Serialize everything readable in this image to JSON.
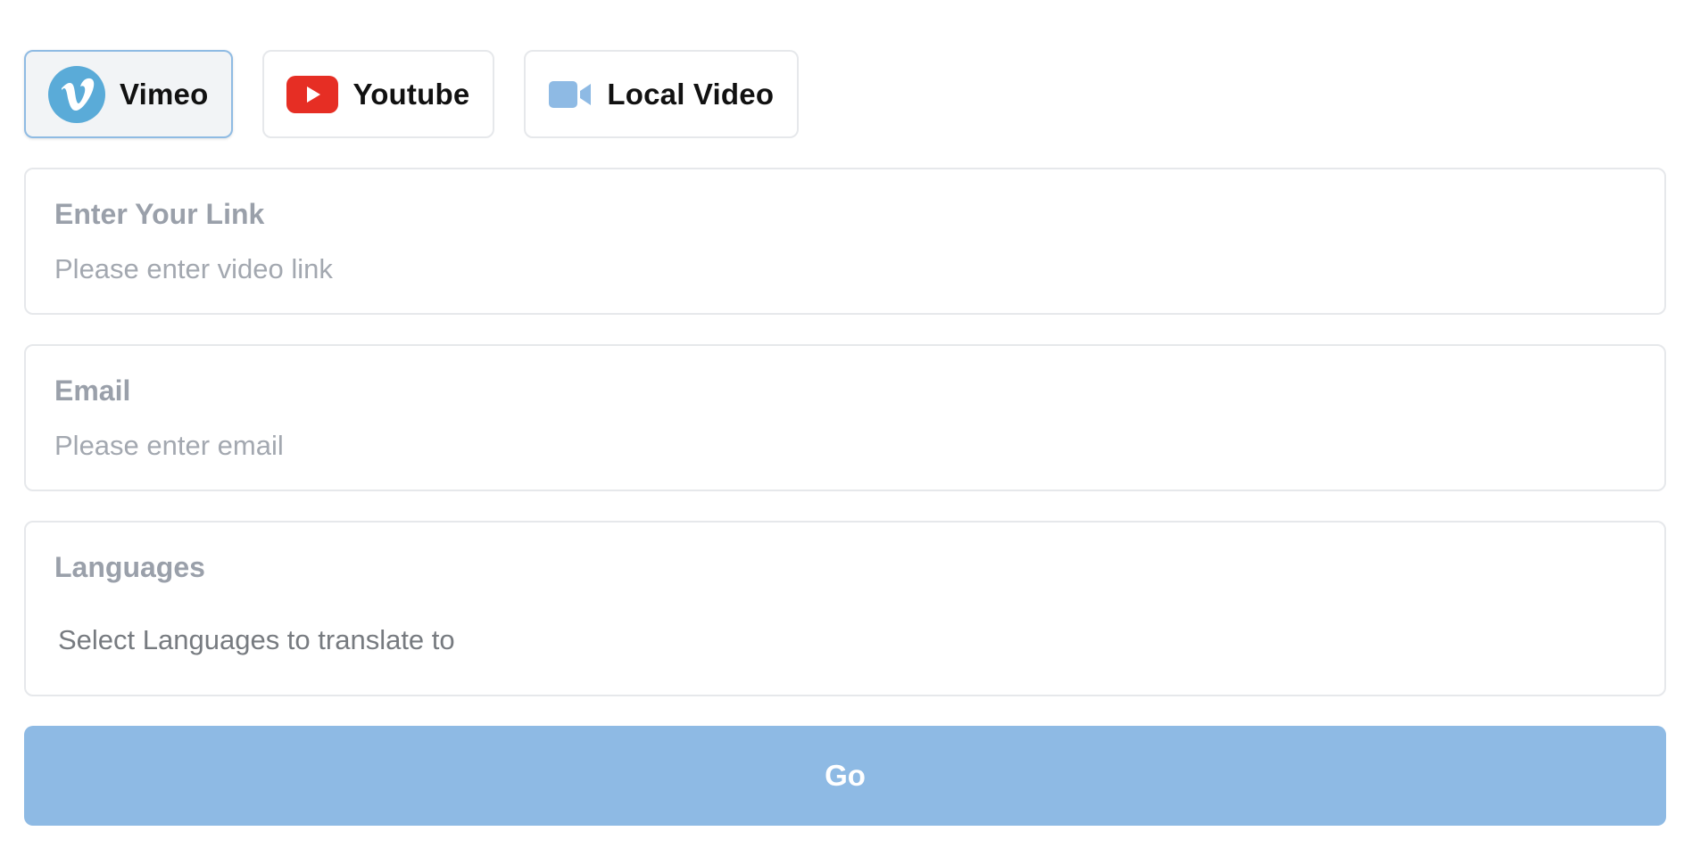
{
  "colors": {
    "vimeo": "#5aabd8",
    "youtube": "#e62e24",
    "local_video": "#8ebae4",
    "go_button": "#8ebae4",
    "active_border": "#8fbbe3"
  },
  "sources": [
    {
      "label": "Vimeo",
      "icon": "vimeo-icon",
      "selected": true
    },
    {
      "label": "Youtube",
      "icon": "youtube-icon",
      "selected": false
    },
    {
      "label": "Local Video",
      "icon": "video-camera-icon",
      "selected": false
    }
  ],
  "form": {
    "link": {
      "label": "Enter Your Link",
      "placeholder": "Please enter video link",
      "value": ""
    },
    "email": {
      "label": "Email",
      "placeholder": "Please enter email",
      "value": ""
    },
    "languages": {
      "label": "Languages",
      "placeholder": "Select Languages to translate to"
    },
    "submit_label": "Go"
  }
}
